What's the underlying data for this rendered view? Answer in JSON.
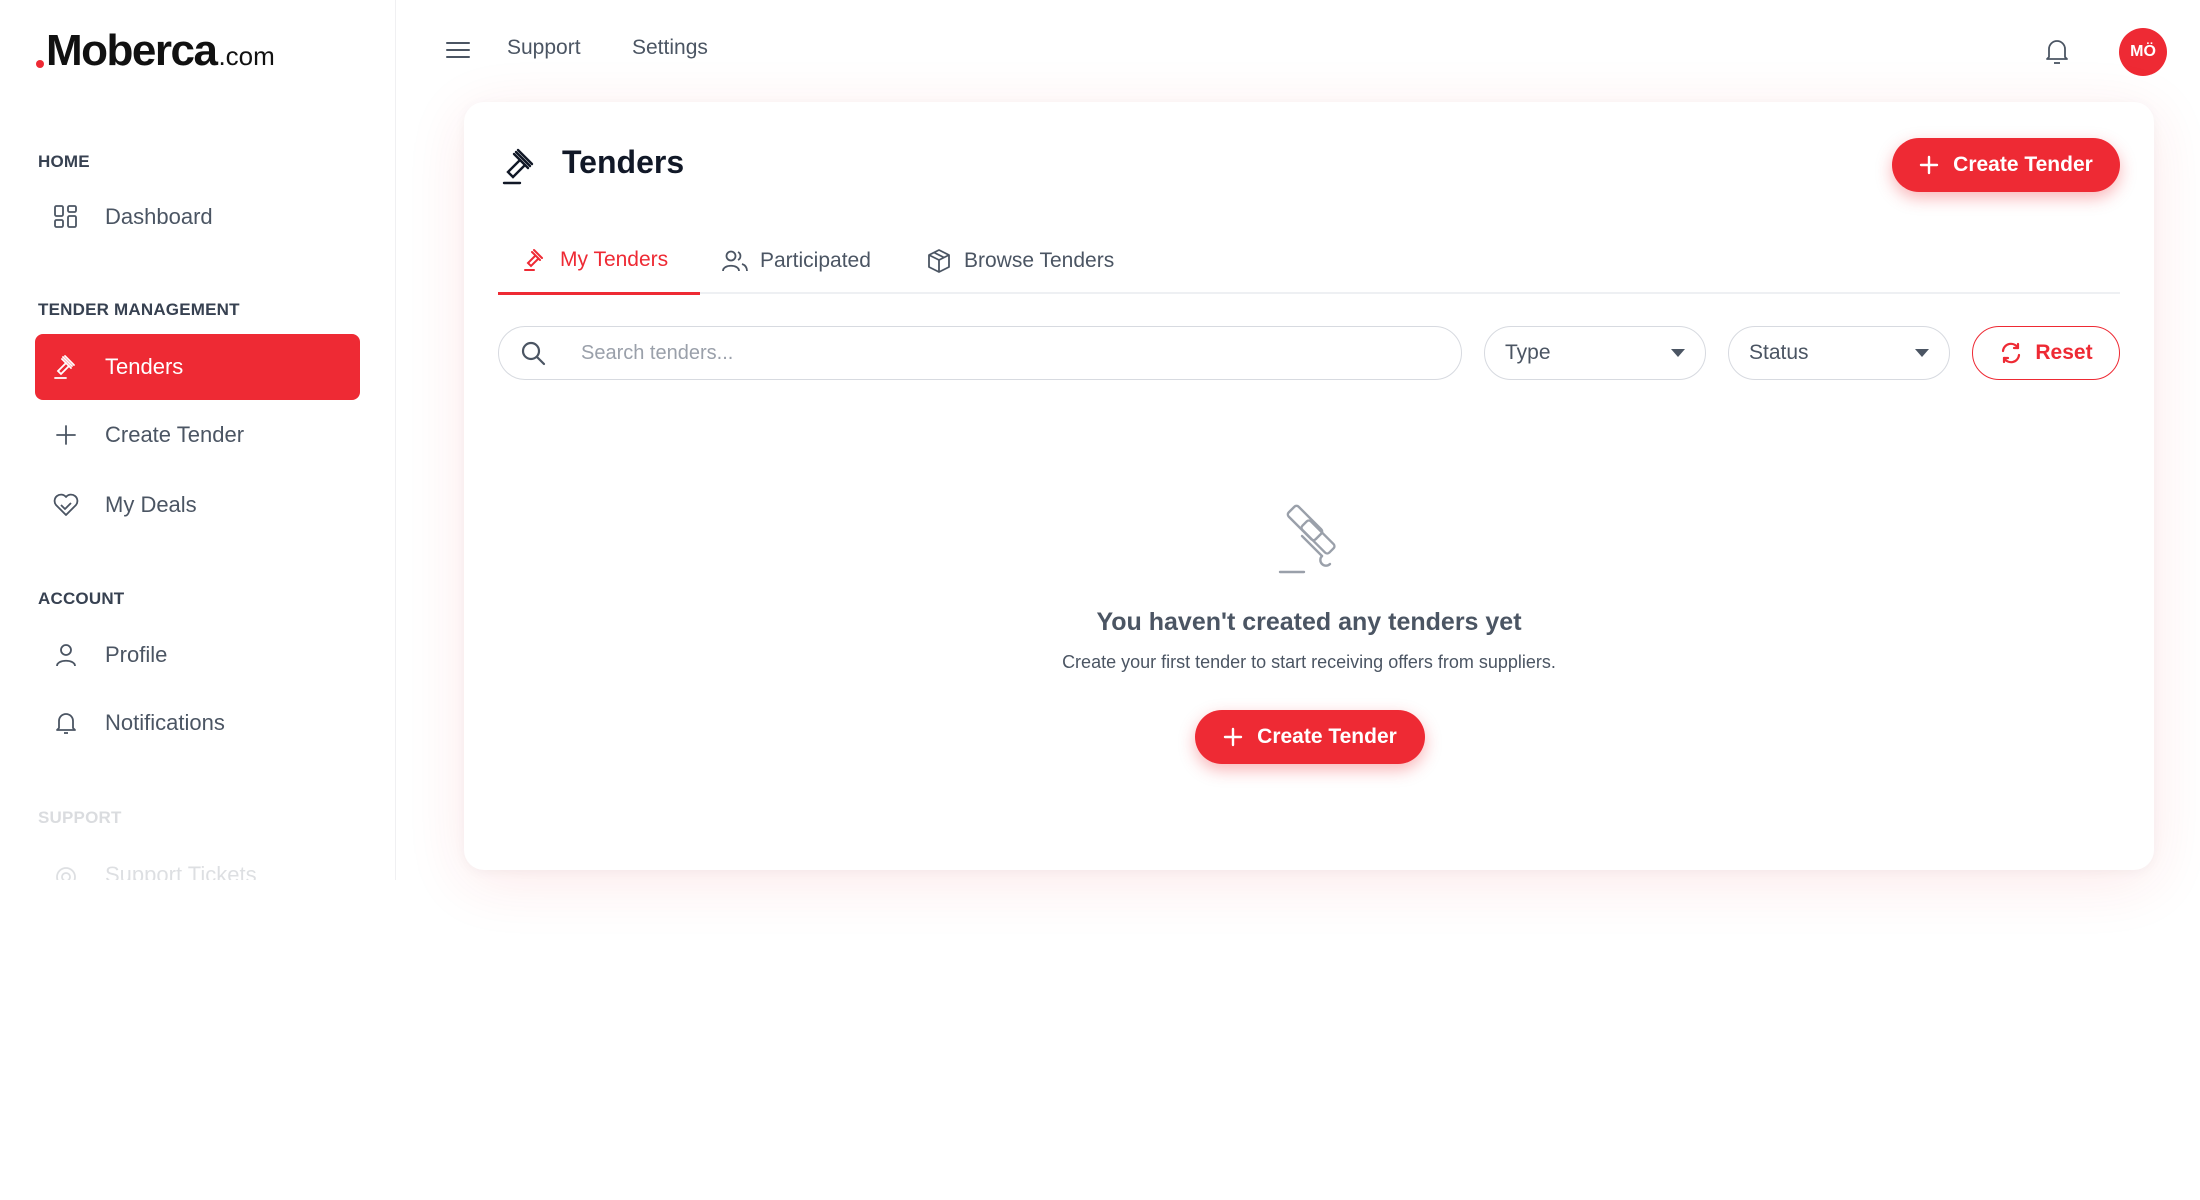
{
  "brand": {
    "name": "Moberca",
    "tld": ".com"
  },
  "sidebar": {
    "sections": [
      {
        "title": "HOME",
        "items": [
          {
            "label": "Dashboard",
            "icon": "dashboard-icon"
          }
        ]
      },
      {
        "title": "TENDER MANAGEMENT",
        "items": [
          {
            "label": "Tenders",
            "icon": "gavel-icon",
            "active": true
          },
          {
            "label": "Create Tender",
            "icon": "plus-icon"
          },
          {
            "label": "My Deals",
            "icon": "handshake-heart-icon"
          }
        ]
      },
      {
        "title": "ACCOUNT",
        "items": [
          {
            "label": "Profile",
            "icon": "user-icon"
          },
          {
            "label": "Notifications",
            "icon": "bell-icon"
          }
        ]
      },
      {
        "title": "SUPPORT",
        "items": [
          {
            "label": "Support Tickets",
            "icon": "support-icon"
          }
        ]
      }
    ]
  },
  "topbar": {
    "links": [
      "Support",
      "Settings"
    ],
    "avatar_initials": "MÖ"
  },
  "page": {
    "title": "Tenders",
    "create_button": "Create Tender",
    "tabs": [
      {
        "label": "My Tenders",
        "icon": "gavel-icon",
        "active": true
      },
      {
        "label": "Participated",
        "icon": "users-icon"
      },
      {
        "label": "Browse Tenders",
        "icon": "cube-icon"
      }
    ],
    "filters": {
      "search_placeholder": "Search tenders...",
      "search_value": "",
      "type_label": "Type",
      "status_label": "Status",
      "reset_label": "Reset"
    },
    "empty_state": {
      "title": "You haven't created any tenders yet",
      "subtitle": "Create your first tender to start receiving offers from suppliers.",
      "button": "Create Tender"
    }
  },
  "colors": {
    "accent": "#ee2a34",
    "text": "#4b5563",
    "border": "#d7dae0"
  }
}
